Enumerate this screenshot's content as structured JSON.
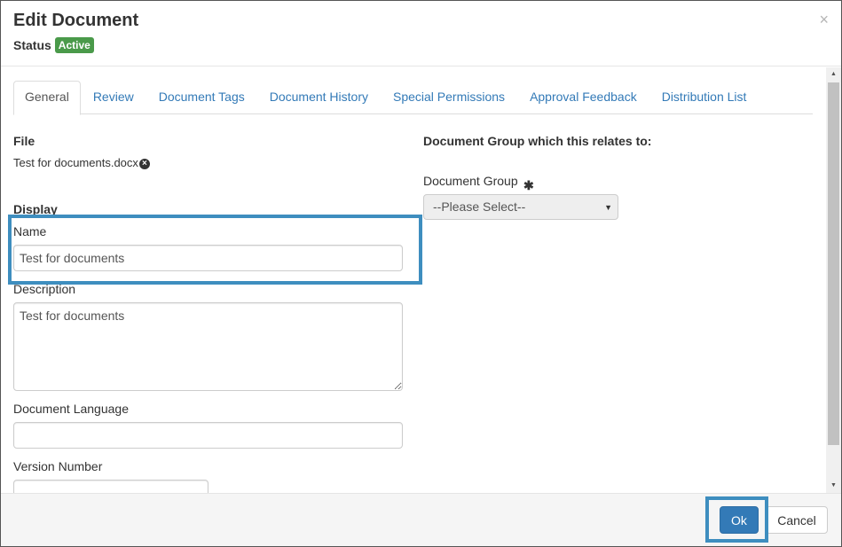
{
  "dialog": {
    "title": "Edit Document",
    "status_label": "Status",
    "status_badge": "Active",
    "close_glyph": "×"
  },
  "tabs": [
    {
      "label": "General",
      "active": true
    },
    {
      "label": "Review",
      "active": false
    },
    {
      "label": "Document Tags",
      "active": false
    },
    {
      "label": "Document History",
      "active": false
    },
    {
      "label": "Special Permissions",
      "active": false
    },
    {
      "label": "Approval Feedback",
      "active": false
    },
    {
      "label": "Distribution List",
      "active": false
    }
  ],
  "file": {
    "heading": "File",
    "name": "Test for documents.docx",
    "remove_icon": "remove-circle-icon"
  },
  "display": {
    "heading": "Display",
    "name_label": "Name",
    "name_value": "Test for documents",
    "description_label": "Description",
    "description_value": "Test for documents",
    "language_label": "Document Language",
    "language_value": "",
    "version_label": "Version Number",
    "version_value": ""
  },
  "group": {
    "heading": "Document Group which this relates to:",
    "label": "Document Group",
    "required_mark": "✱",
    "selected": "--Please Select--"
  },
  "footer": {
    "ok_label": "Ok",
    "cancel_label": "Cancel"
  },
  "colors": {
    "badge_green": "#4a9a4a",
    "link_blue": "#337ab7",
    "primary_button": "#337ab7",
    "highlight_border": "#3e8ebf"
  }
}
